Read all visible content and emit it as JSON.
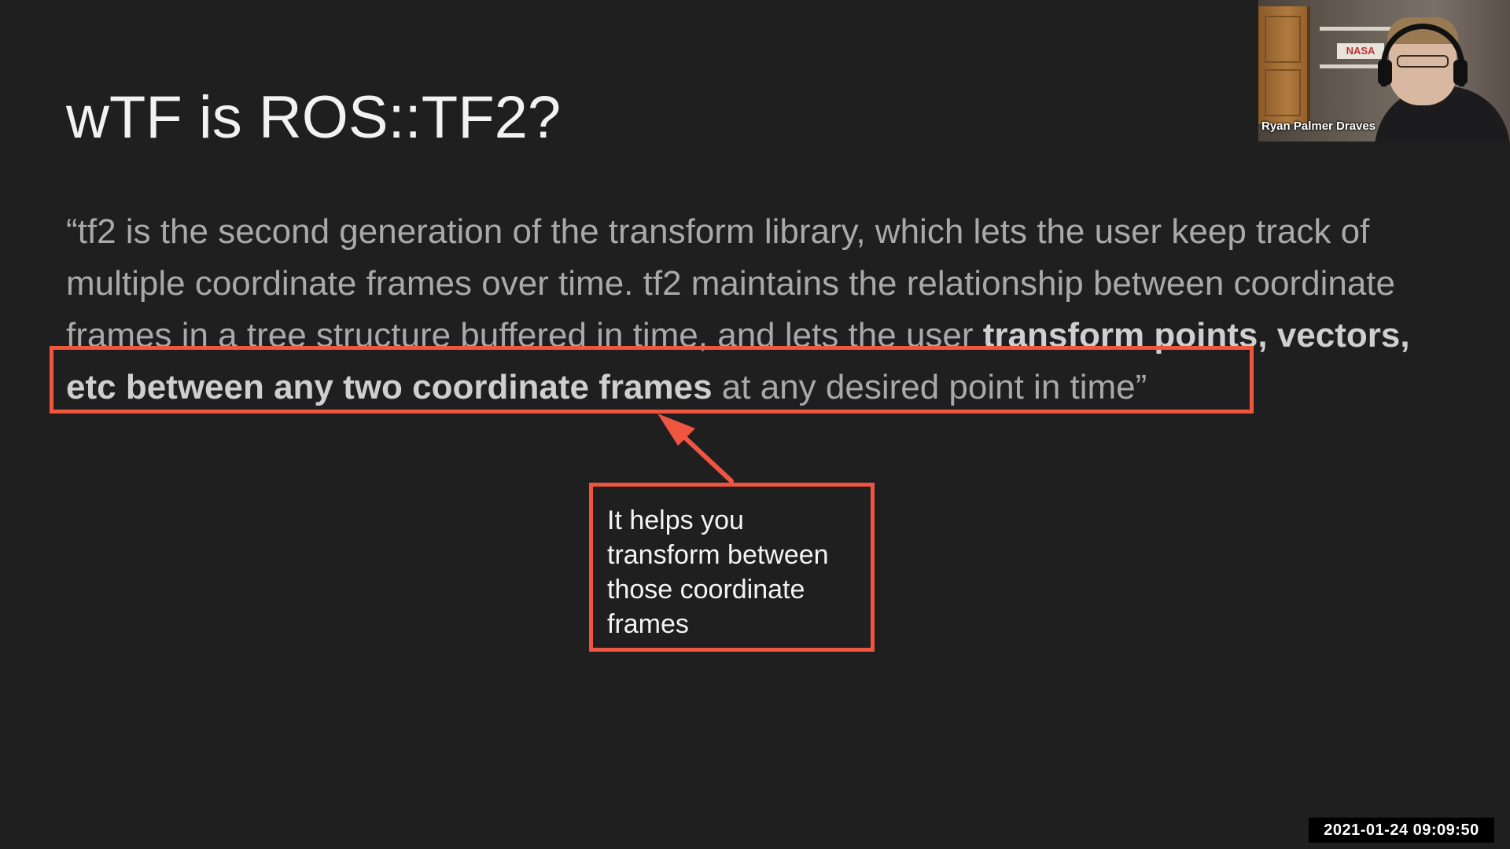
{
  "slide": {
    "title": "wTF is ROS::TF2?",
    "quote_part1": "“tf2 is the second generation of the transform library, which lets the user keep track of multiple coordinate frames over time. tf2 maintains the relationship between coordinate frames in a tree structure buffered in time, and lets the user ",
    "quote_highlight": "transform points, vectors, etc between any two coordinate frames",
    "quote_part2": " at any desired point in time”",
    "callout": "It helps you transform between those coordinate frames"
  },
  "colors": {
    "background": "#1f1f20",
    "annotation": "#f05540",
    "title_text": "#f2f2f2",
    "body_text": "#a9a9a9"
  },
  "webcam": {
    "participant_name": "Ryan Palmer Draves",
    "poster_text": "NASA"
  },
  "recording": {
    "timestamp": "2021-01-24 09:09:50"
  }
}
